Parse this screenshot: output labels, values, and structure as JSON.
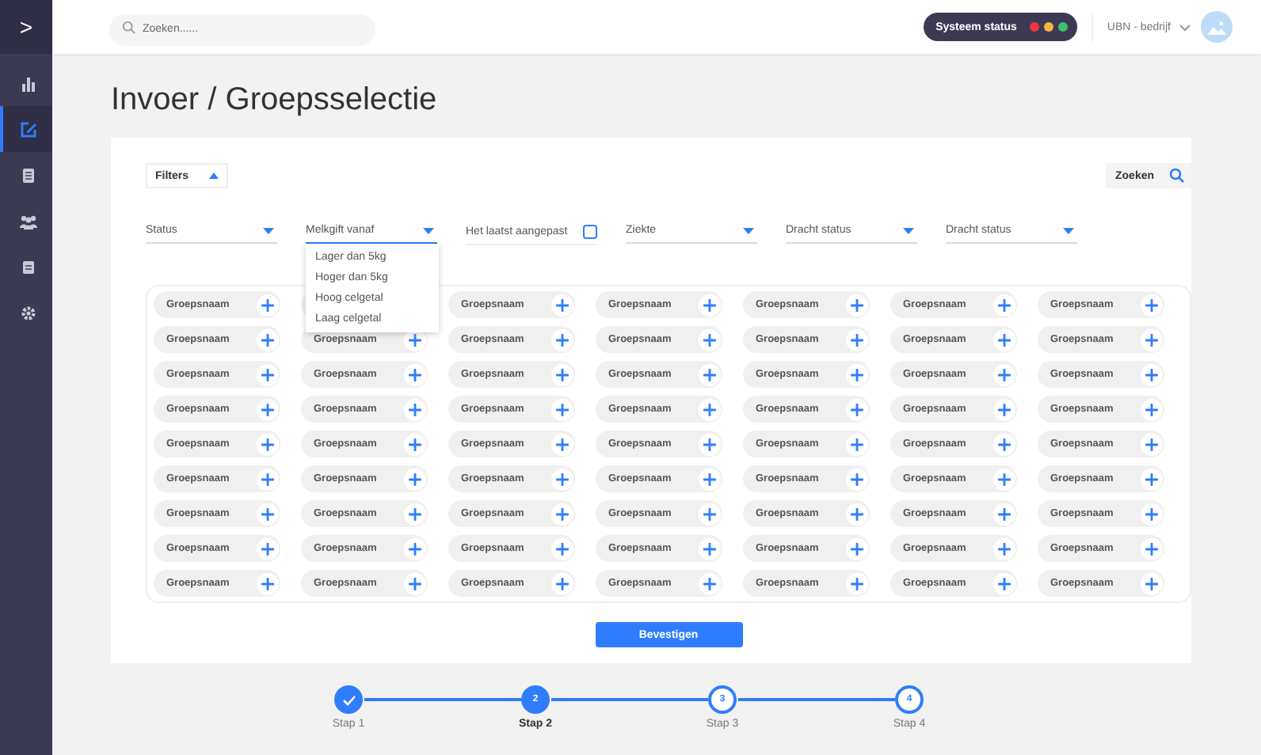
{
  "sidebar": {
    "toggle": ">",
    "items": [
      {
        "selected": false
      },
      {
        "selected": true
      },
      {
        "selected": false
      },
      {
        "selected": false
      },
      {
        "selected": false
      },
      {
        "selected": false
      }
    ]
  },
  "topbar": {
    "search": {
      "placeholder": "Zoeken......"
    },
    "system_status": {
      "label": "Systeem status",
      "lights": [
        {
          "color": "#e8383d"
        },
        {
          "color": "#f5b53f"
        },
        {
          "color": "#3fbf6a"
        }
      ]
    },
    "company": "UBN - bedrijf"
  },
  "title": "Invoer / Groepsselectie",
  "filters_button": {
    "label": "Filters",
    "expanded": true
  },
  "search_button": {
    "label": "Zoeken"
  },
  "filters": [
    {
      "kind": "dropdown",
      "label": "Status",
      "open": false
    },
    {
      "kind": "dropdown",
      "label": "Melkgift vanaf",
      "open": true,
      "options": [
        "Lager dan 5kg",
        "Hoger dan 5kg",
        "Hoog celgetal",
        "Laag celgetal"
      ]
    },
    {
      "kind": "checkbox",
      "label": "Het laatst aangepast",
      "checked": false
    },
    {
      "kind": "dropdown",
      "label": "Ziekte",
      "open": false
    },
    {
      "kind": "dropdown",
      "label": "Dracht status",
      "open": false
    },
    {
      "kind": "dropdown",
      "label": "Dracht status",
      "open": false
    }
  ],
  "groups": [
    [
      {
        "label": "Groepsnaam"
      },
      {
        "kind": "covered"
      },
      {
        "label": "Groepsnaam"
      },
      {
        "label": "Groepsnaam"
      },
      {
        "label": "Groepsnaam"
      },
      {
        "label": "Groepsnaam"
      },
      {
        "label": "Groepsnaam"
      }
    ],
    [
      {
        "label": "Groepsnaam"
      },
      {
        "label": "Groepsnaam"
      },
      {
        "label": "Groepsnaam"
      },
      {
        "label": "Groepsnaam"
      },
      {
        "label": "Groepsnaam"
      },
      {
        "label": "Groepsnaam"
      },
      {
        "label": "Groepsnaam"
      }
    ],
    [
      {
        "label": "Groepsnaam"
      },
      {
        "label": "Groepsnaam"
      },
      {
        "label": "Groepsnaam"
      },
      {
        "label": "Groepsnaam"
      },
      {
        "label": "Groepsnaam"
      },
      {
        "label": "Groepsnaam"
      },
      {
        "label": "Groepsnaam"
      }
    ],
    [
      {
        "label": "Groepsnaam"
      },
      {
        "label": "Groepsnaam"
      },
      {
        "label": "Groepsnaam"
      },
      {
        "label": "Groepsnaam"
      },
      {
        "label": "Groepsnaam"
      },
      {
        "label": "Groepsnaam"
      },
      {
        "label": "Groepsnaam"
      }
    ],
    [
      {
        "label": "Groepsnaam"
      },
      {
        "label": "Groepsnaam"
      },
      {
        "label": "Groepsnaam"
      },
      {
        "label": "Groepsnaam"
      },
      {
        "label": "Groepsnaam"
      },
      {
        "label": "Groepsnaam"
      },
      {
        "label": "Groepsnaam"
      }
    ],
    [
      {
        "label": "Groepsnaam"
      },
      {
        "label": "Groepsnaam"
      },
      {
        "label": "Groepsnaam"
      },
      {
        "label": "Groepsnaam"
      },
      {
        "label": "Groepsnaam"
      },
      {
        "label": "Groepsnaam"
      },
      {
        "label": "Groepsnaam"
      }
    ],
    [
      {
        "label": "Groepsnaam"
      },
      {
        "label": "Groepsnaam"
      },
      {
        "label": "Groepsnaam"
      },
      {
        "label": "Groepsnaam"
      },
      {
        "label": "Groepsnaam"
      },
      {
        "label": "Groepsnaam"
      },
      {
        "label": "Groepsnaam"
      }
    ],
    [
      {
        "label": "Groepsnaam"
      },
      {
        "label": "Groepsnaam"
      },
      {
        "label": "Groepsnaam"
      },
      {
        "label": "Groepsnaam"
      },
      {
        "label": "Groepsnaam"
      },
      {
        "label": "Groepsnaam"
      },
      {
        "label": "Groepsnaam"
      }
    ],
    [
      {
        "label": "Groepsnaam"
      },
      {
        "label": "Groepsnaam"
      },
      {
        "label": "Groepsnaam"
      },
      {
        "label": "Groepsnaam"
      },
      {
        "label": "Groepsnaam"
      },
      {
        "label": "Groepsnaam"
      },
      {
        "label": "Groepsnaam"
      }
    ]
  ],
  "confirm_button": {
    "label": "Bevestigen"
  },
  "steps": [
    {
      "label": "Stap 1",
      "kind": "done"
    },
    {
      "label": "Stap 2",
      "number": "2",
      "kind": "current"
    },
    {
      "label": "Stap 3",
      "number": "3",
      "kind": "upcoming"
    },
    {
      "label": "Stap 4",
      "number": "4",
      "kind": "upcoming"
    }
  ]
}
